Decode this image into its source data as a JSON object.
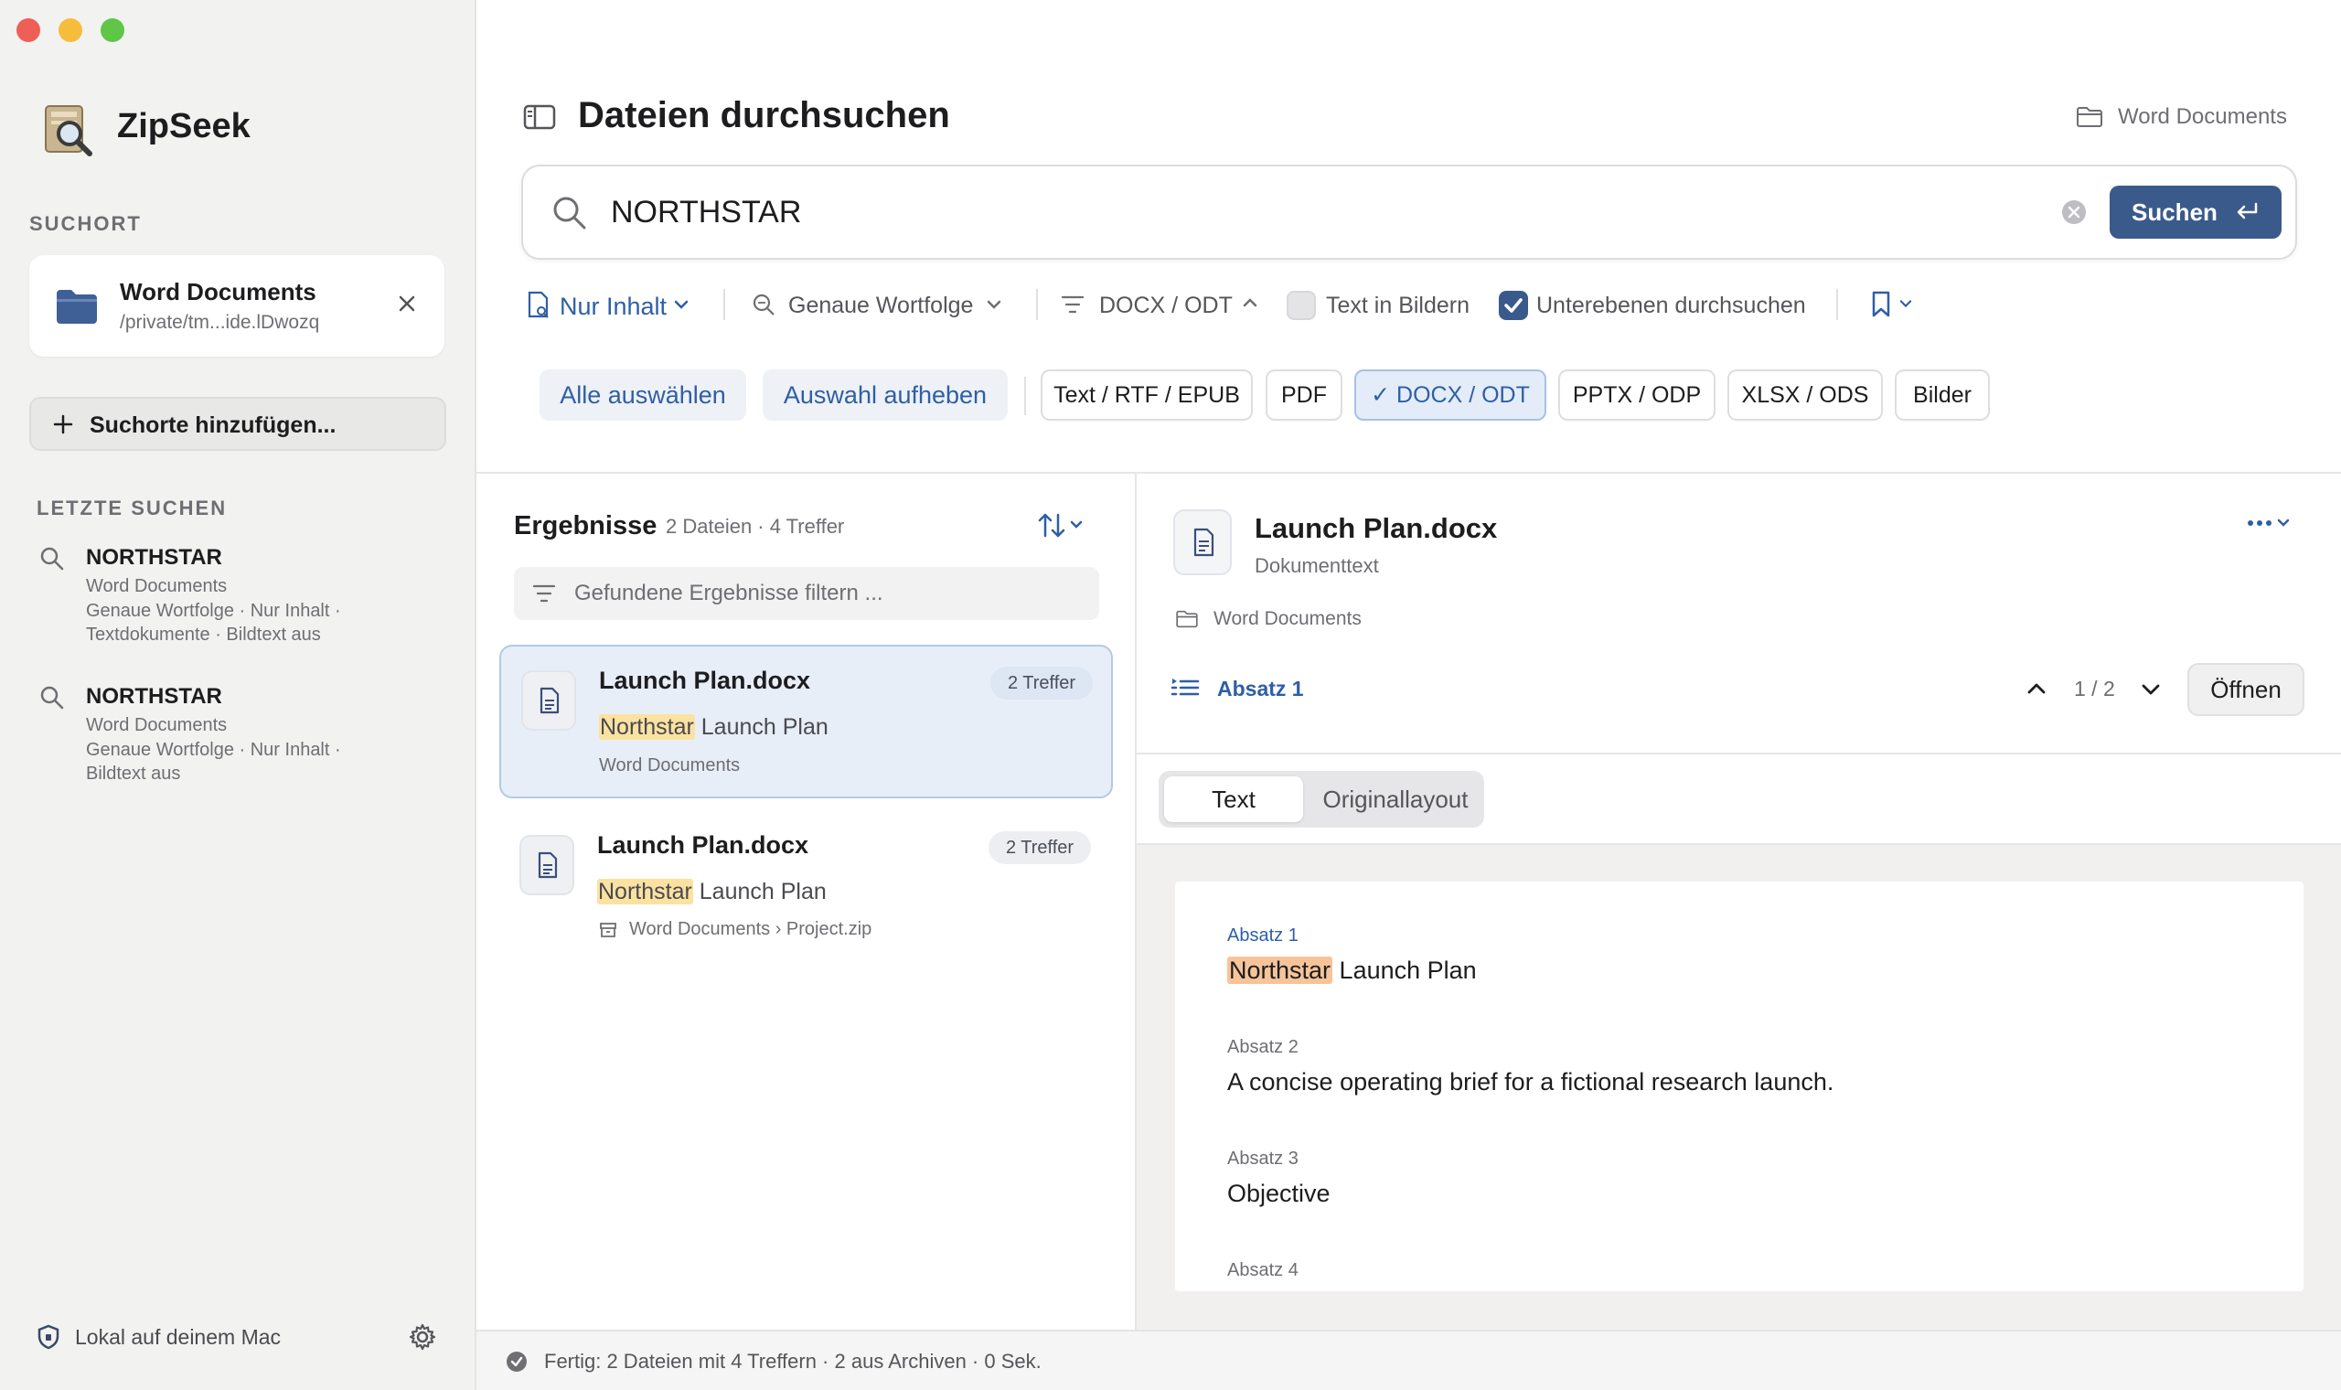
{
  "app": {
    "name": "ZipSeek",
    "colors": {
      "accent": "#3a5a8c",
      "highlight": "#fbe2a1",
      "highlight_active": "#f7c49a",
      "link": "#2e5fa6"
    }
  },
  "sidebar": {
    "location_label": "SUCHORT",
    "location": {
      "name": "Word Documents",
      "path": "/private/tm...ide.lDwozq"
    },
    "add_button": "Suchorte hinzufügen...",
    "recent_label": "LETZTE SUCHEN",
    "recent": [
      {
        "query": "NORTHSTAR",
        "location": "Word Documents",
        "details_1": "Genaue Wortfolge · Nur Inhalt ·",
        "details_2": "Textdokumente · Bildtext aus"
      },
      {
        "query": "NORTHSTAR",
        "location": "Word Documents",
        "details_1": "Genaue Wortfolge · Nur Inhalt ·",
        "details_2": "Bildtext aus"
      }
    ],
    "footer": "Lokal auf deinem Mac"
  },
  "header": {
    "title": "Dateien durchsuchen",
    "scope": "Word Documents"
  },
  "search": {
    "query": "NORTHSTAR",
    "button": "Suchen"
  },
  "options": {
    "content_mode": "Nur Inhalt",
    "match_mode": "Genaue Wortfolge",
    "format_filter": "DOCX / ODT",
    "text_in_images": {
      "label": "Text in Bildern",
      "checked": false
    },
    "subfolders": {
      "label": "Unterebenen durchsuchen",
      "checked": true
    }
  },
  "chips": {
    "select_all": "Alle auswählen",
    "deselect": "Auswahl aufheben",
    "types": [
      {
        "label": "Text / RTF / EPUB",
        "selected": false
      },
      {
        "label": "PDF",
        "selected": false
      },
      {
        "label": "✓ DOCX / ODT",
        "selected": true
      },
      {
        "label": "PPTX / ODP",
        "selected": false
      },
      {
        "label": "XLSX / ODS",
        "selected": false
      },
      {
        "label": "Bilder",
        "selected": false
      }
    ]
  },
  "results": {
    "title": "Ergebnisse",
    "summary": "2 Dateien · 4 Treffer",
    "filter_placeholder": "Gefundene Ergebnisse filtern ...",
    "items": [
      {
        "file": "Launch Plan.docx",
        "hits": "2 Treffer",
        "match": "Northstar",
        "rest": " Launch Plan",
        "location": "Word Documents",
        "selected": true
      },
      {
        "file": "Launch Plan.docx",
        "hits": "2 Treffer",
        "match": "Northstar",
        "rest": " Launch Plan",
        "location": "Word Documents › Project.zip",
        "selected": false
      }
    ]
  },
  "detail": {
    "file": "Launch Plan.docx",
    "kind": "Dokumenttext",
    "location": "Word Documents",
    "section": "Absatz 1",
    "pager": "1 / 2",
    "open_button": "Öffnen",
    "tabs": [
      "Text",
      "Originallayout"
    ],
    "paragraphs": [
      {
        "label": "Absatz 1",
        "match": "Northstar",
        "text": " Launch Plan"
      },
      {
        "label": "Absatz 2",
        "text": "A concise operating brief for a fictional research launch."
      },
      {
        "label": "Absatz 3",
        "text": "Objective"
      },
      {
        "label": "Absatz 4",
        "text": ""
      }
    ]
  },
  "status": {
    "text": "Fertig: 2 Dateien mit 4 Treffern · 2 aus Archiven · 0 Sek."
  }
}
